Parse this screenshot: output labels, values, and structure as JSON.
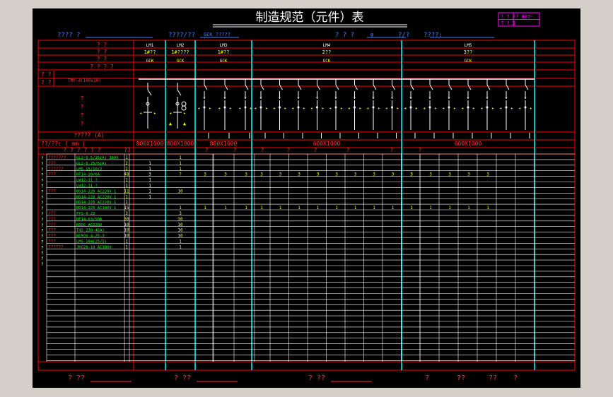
{
  "title": "制造规范（元件）表",
  "doc_code": {
    "r1": "? ?  ?? 007-",
    "r2": "? ?    3"
  },
  "header_fields": [
    {
      "label": "???? ?",
      "value": ""
    },
    {
      "label": "????/??",
      "value": "GCK   ?????"
    },
    {
      "label": "? ? ?",
      "value": "φ"
    },
    {
      "label": "?/?",
      "value": ""
    },
    {
      "label": "????:",
      "value": ""
    }
  ],
  "row_labels": {
    "r1": "?     ?",
    "r2": "?     ?",
    "r3": "?     ?",
    "r4": "? ? ? ?",
    "busbar_a": "? ?",
    "busbar_b": "? ?",
    "busbar_spec": "TMY-4(100x10)",
    "scheme": "?\n?\n?\n?",
    "current": "????? (A)",
    "dims": "??/??:  ( mm )"
  },
  "panels": [
    {
      "id": "LM1",
      "line2": "1#??",
      "type": "GCK",
      "dim": "800X1000"
    },
    {
      "id": "LM2",
      "line2": "1#????",
      "type": "GCK",
      "dim": "800X1000"
    },
    {
      "id": "LM3",
      "line2": "1#??",
      "type": "GCK",
      "dim": "800X1000"
    },
    {
      "id": "LM4",
      "line2": "2??",
      "type": "GCK",
      "dim": "600X1000"
    },
    {
      "id": "LM5",
      "line2": "3??",
      "type": "GCK",
      "dim": "600X1000"
    }
  ],
  "table_headers": {
    "name": "? ?  ? ?  ? ?",
    "qty": "??",
    "col_marks": [
      "?",
      "?",
      "?",
      "?",
      "?",
      "?",
      "?",
      "?"
    ]
  },
  "components": [
    {
      "cat": "???????",
      "model": "GL2-0.5/25(A) 380V",
      "qty": "1",
      "c1": "",
      "c2": "1",
      "vals": []
    },
    {
      "cat": "???",
      "model": "GL2-0.25/5(A)",
      "qty": "2",
      "c1": "1",
      "c2": "1",
      "vals": []
    },
    {
      "cat": "??????",
      "model": "LMS-15/10/2",
      "qty": "2",
      "c1": "1",
      "c2": "1",
      "vals": []
    },
    {
      "cat": "???",
      "model": "RT14-20/6A",
      "qty": "48",
      "c1": "3",
      "c2": "?",
      "vals": [
        "3",
        "3",
        "3",
        "3",
        "3",
        "3",
        "3",
        "3",
        "3",
        "3",
        "3",
        "3",
        "3",
        "3",
        "3",
        "3",
        "3"
      ]
    },
    {
      "cat": "",
      "model": "LW12-11 ?",
      "qty": "1",
      "c1": "1",
      "c2": "",
      "vals": []
    },
    {
      "cat": "",
      "model": "LW12-11 ?",
      "qty": "1",
      "c1": "1",
      "c2": "",
      "vals": []
    },
    {
      "cat": "???",
      "model": "RD14-220 AC220V 1",
      "qty": "11",
      "c1": "1",
      "c2": "10",
      "vals": []
    },
    {
      "cat": "",
      "model": "RD14-220 AC220V 1",
      "qty": "1",
      "c1": "1",
      "c2": "",
      "vals": []
    },
    {
      "cat": "",
      "model": "RD14-220 AC220V 1",
      "qty": "1",
      "c1": "",
      "c2": "",
      "vals": []
    },
    {
      "cat": "",
      "model": "RD14-220 AC380V 1",
      "qty": "15",
      "c1": "",
      "c2": "1",
      "vals": [
        "1",
        "1",
        "1",
        "1",
        "1",
        "1",
        "1",
        "1",
        "1",
        "1",
        "1",
        "1",
        "1",
        "1",
        "1",
        "1",
        "1"
      ]
    },
    {
      "cat": "???",
      "model": "FYS-0.22",
      "qty": "3",
      "c1": "",
      "c2": "3",
      "vals": []
    },
    {
      "cat": "???",
      "model": "RT14-63/50A",
      "qty": "30",
      "c1": "",
      "c2": "30",
      "vals": []
    },
    {
      "cat": "???",
      "model": "B30C AC220V",
      "qty": "10",
      "c1": "",
      "c2": "10",
      "vals": []
    },
    {
      "cat": "???",
      "model": "T45 230-45A)",
      "qty": "10",
      "c1": "",
      "c2": "10",
      "vals": []
    },
    {
      "cat": "???",
      "model": "BCMJ0.4-25-3",
      "qty": "10",
      "c1": "",
      "c2": "10",
      "vals": []
    },
    {
      "cat": "???",
      "model": "LMS-16W(25/5)",
      "qty": "1",
      "c1": "",
      "c2": "1",
      "vals": []
    },
    {
      "cat": "??????",
      "model": "JKG2B-10 AC380V",
      "qty": "1",
      "c1": "",
      "c2": "1",
      "vals": []
    }
  ],
  "side_labels": [
    "?",
    "?",
    "?",
    "?",
    "?",
    "?",
    "?",
    "?",
    "?",
    "?",
    "?",
    "?",
    "?",
    "?",
    "?",
    "?",
    "?",
    "?",
    "?",
    "?"
  ],
  "footer": [
    {
      "label": "? ??",
      "value": ""
    },
    {
      "label": "? ??",
      "value": ""
    },
    {
      "label": "? ??",
      "value": ""
    },
    {
      "label": "?",
      "value": "?"
    },
    {
      "label": "??",
      "value": "??"
    },
    {
      "label": "?",
      "value": ""
    }
  ],
  "colors": {
    "background": "#000000",
    "grid": "#ff0000",
    "panel_divider": "#00ffff",
    "text_white": "#ffffff",
    "text_red": "#ff3030",
    "text_yellow": "#ffff00",
    "text_green": "#00ff00",
    "stamp": "#ff00ff",
    "chrome": "#d4d0c8"
  }
}
